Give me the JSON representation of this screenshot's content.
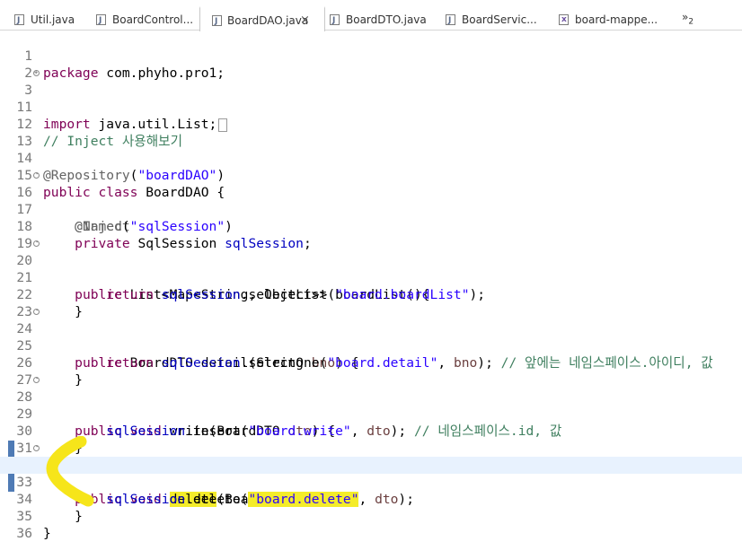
{
  "tabs": [
    {
      "label": "Util.java",
      "icon": "java-file-icon",
      "active": false
    },
    {
      "label": "BoardControl...",
      "icon": "java-file-icon",
      "active": false
    },
    {
      "label": "BoardDAO.java",
      "icon": "java-file-icon",
      "active": true
    },
    {
      "label": "BoardDTO.java",
      "icon": "java-file-icon",
      "active": false
    },
    {
      "label": "BoardServic...",
      "icon": "java-file-icon",
      "active": false
    },
    {
      "label": "board-mappe...",
      "icon": "xml-file-icon",
      "active": false
    }
  ],
  "more_tabs": {
    "symbol": "»",
    "count": "2"
  },
  "close_symbol": "×",
  "line_numbers": [
    "1",
    "2",
    "3",
    "11",
    "12",
    "13",
    "14",
    "15",
    "16",
    "17",
    "18",
    "19",
    "20",
    "21",
    "22",
    "23",
    "24",
    "25",
    "26",
    "27",
    "28",
    "29",
    "30",
    "31",
    "32",
    "33",
    "34",
    "35",
    "36"
  ],
  "code": {
    "l1": {
      "kw": "package",
      "rest": " com.phyho.pro1;"
    },
    "l3": {
      "kw": "import",
      "rest": " java.util.List;"
    },
    "l12": {
      "comment": "// Inject 사용해보기"
    },
    "l14": {
      "ann": "@Repository",
      "p1": "(",
      "str": "\"boardDAO\"",
      "p2": ")"
    },
    "l15": {
      "kw1": "public",
      "kw2": "class",
      "rest": " BoardDAO {"
    },
    "l16": {
      "ann": "@Inject"
    },
    "l17": {
      "ann": "@Named",
      "p1": "(",
      "str": "\"sqlSession\"",
      "p2": ")"
    },
    "l18": {
      "kw": "private",
      "type": " SqlSession ",
      "field": "sqlSession",
      "end": ";"
    },
    "l20": {
      "kw": "public",
      "rest": " List<Map<String, Object>> boardList(){"
    },
    "l21": {
      "kw": "return",
      "field": "sqlSession",
      "call": ".selectList(",
      "str": "\"board.boardList\"",
      "end": ");"
    },
    "l22": {
      "text": "}"
    },
    "l24": {
      "kw": "public",
      "rest1": " BoardDTO detail(String ",
      "param": "bno",
      "rest2": ") {"
    },
    "l25": {
      "kw": "return",
      "field": "sqlSession",
      "call": ".selectOne(",
      "str": "\"board.detail\"",
      "mid": ", ",
      "param": "bno",
      "end": "); ",
      "comment": "// 앞에는 네임스페이스.아이디, 값"
    },
    "l26": {
      "text": "}"
    },
    "l28": {
      "kw1": "public",
      "kw2": "void",
      "rest1": " write(BoardDTO ",
      "param": "dto",
      "rest2": ") {"
    },
    "l29": {
      "field": "sqlSession",
      "call": ".insert(",
      "str": "\"board.write\"",
      "mid": ", ",
      "param": "dto",
      "end": "); ",
      "comment": "// 네임스페이스.id, 값"
    },
    "l30": {
      "text": "}"
    },
    "l32": {
      "kw1": "public",
      "kw2": "void",
      "method": "delete",
      "rest1": "(BoardDTO ",
      "param": "dto",
      "rest2": ") {"
    },
    "l33": {
      "field": "sqlSession",
      "call": ".delete(",
      "str": "\"board.delete\"",
      "mid": ", ",
      "param": "dto",
      "end": ");"
    },
    "l34": {
      "text": "}"
    },
    "l35": {
      "text": "}"
    }
  },
  "colors": {
    "keyword": "#7f0055",
    "string": "#2a00ff",
    "annotation": "#646464",
    "comment": "#3f7f5f",
    "field": "#0000c0",
    "highlight": "#f4ec2a",
    "current_line": "#e8f2fe"
  }
}
